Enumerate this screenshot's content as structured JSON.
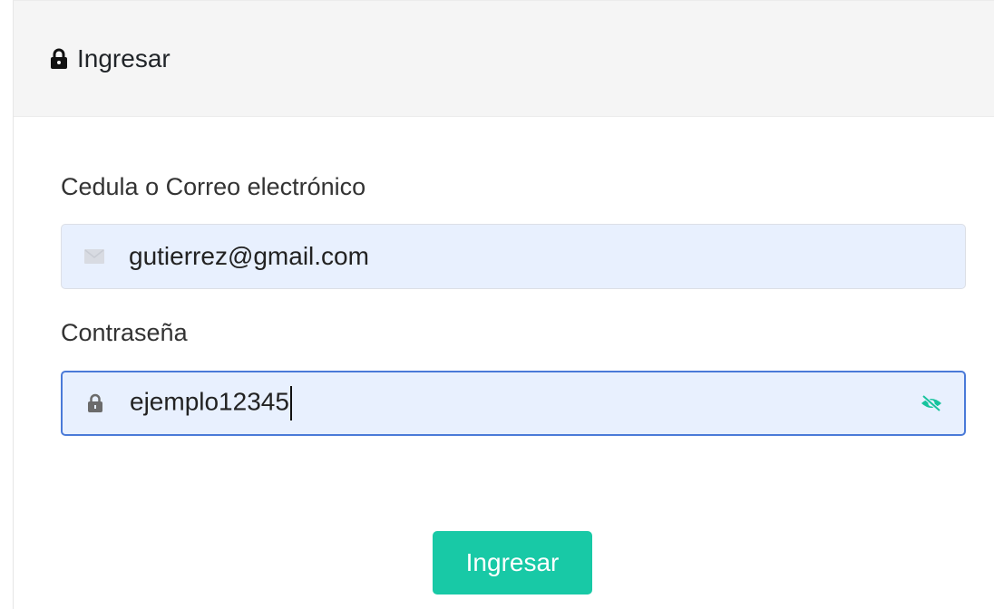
{
  "header": {
    "icon": "lock-icon",
    "title": "Ingresar"
  },
  "form": {
    "user_field": {
      "label": "Cedula o Correo electrónico",
      "icon": "envelope-icon",
      "value": "gutierrez@gmail.com"
    },
    "password_field": {
      "label": "Contraseña",
      "icon": "lock-icon",
      "value": "ejemplo12345",
      "toggle_icon": "eye-slash-icon",
      "focused": true
    },
    "submit_label": "Ingresar"
  },
  "colors": {
    "accent": "#18c9a6",
    "toggle_icon": "#17c39d",
    "focus_border": "#4a7ad8",
    "autofill_bg": "#e8f0fe",
    "header_bg": "#f5f5f5"
  }
}
